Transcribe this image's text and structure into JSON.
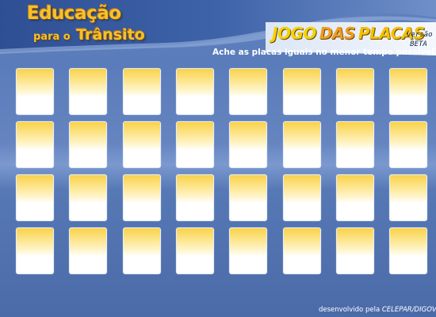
{
  "header": {
    "logo": {
      "line1": "Educação",
      "line2_small": "para o",
      "line2_big": "Trânsito"
    },
    "game_title": {
      "word1": "JOGO",
      "word2": "DAS",
      "word3": "PLACAS"
    },
    "version": {
      "line1": "versão",
      "line2": "BETA"
    },
    "subtitle": "Ache as placas iguais no menor tempo possível!"
  },
  "board": {
    "rows": 4,
    "cols": 8,
    "cards": [
      {
        "id": 1,
        "face": "down"
      },
      {
        "id": 2,
        "face": "down"
      },
      {
        "id": 3,
        "face": "down"
      },
      {
        "id": 4,
        "face": "down"
      },
      {
        "id": 5,
        "face": "down"
      },
      {
        "id": 6,
        "face": "down"
      },
      {
        "id": 7,
        "face": "down"
      },
      {
        "id": 8,
        "face": "down"
      },
      {
        "id": 9,
        "face": "down"
      },
      {
        "id": 10,
        "face": "down"
      },
      {
        "id": 11,
        "face": "down"
      },
      {
        "id": 12,
        "face": "down"
      },
      {
        "id": 13,
        "face": "down"
      },
      {
        "id": 14,
        "face": "down"
      },
      {
        "id": 15,
        "face": "down"
      },
      {
        "id": 16,
        "face": "down"
      },
      {
        "id": 17,
        "face": "down"
      },
      {
        "id": 18,
        "face": "down"
      },
      {
        "id": 19,
        "face": "down"
      },
      {
        "id": 20,
        "face": "down"
      },
      {
        "id": 21,
        "face": "down"
      },
      {
        "id": 22,
        "face": "down"
      },
      {
        "id": 23,
        "face": "down"
      },
      {
        "id": 24,
        "face": "down"
      },
      {
        "id": 25,
        "face": "down"
      },
      {
        "id": 26,
        "face": "down"
      },
      {
        "id": 27,
        "face": "down"
      },
      {
        "id": 28,
        "face": "down"
      },
      {
        "id": 29,
        "face": "down"
      },
      {
        "id": 30,
        "face": "down"
      },
      {
        "id": 31,
        "face": "down"
      },
      {
        "id": 32,
        "face": "down"
      }
    ]
  },
  "footer": {
    "prefix": "desenvolvido pela",
    "org": "CELEPAR/DIGOV"
  },
  "colors": {
    "background": "#5a7cba",
    "logo_yellow": "#f4c12a",
    "title_orange": "#f09a1c",
    "card_top": "#f9d24a",
    "card_bottom": "#ffffff"
  }
}
